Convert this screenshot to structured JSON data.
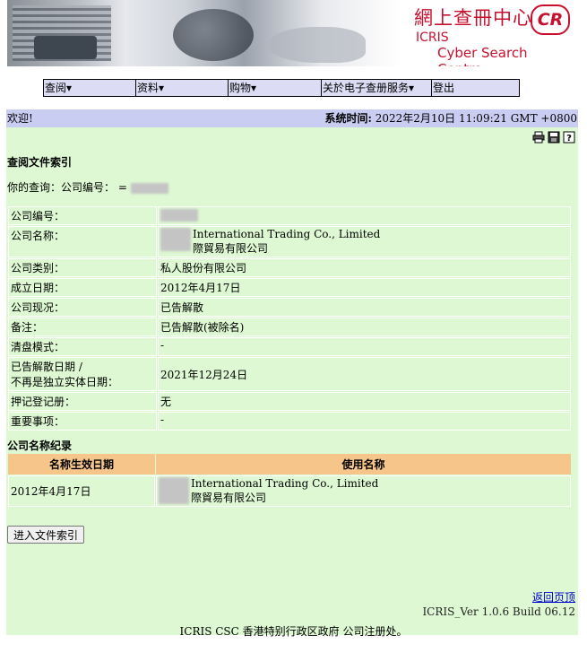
{
  "banner": {
    "title_cn": "網上查冊中心",
    "logo_text": "CR",
    "title_en_line1": "ICRIS",
    "title_en_line2": "Cyber Search Centre"
  },
  "menu": [
    {
      "label": "查阅▾"
    },
    {
      "label": "资料▾"
    },
    {
      "label": "购物▾"
    },
    {
      "label": "关於电子查册服务▾"
    },
    {
      "label": "登出"
    }
  ],
  "welcome": {
    "text": "欢迎!",
    "systime_label": "系统时间:",
    "systime_value": " 2022年2月10日 11:09:21 GMT +0800"
  },
  "toolbar_icons": [
    "printer-icon",
    "save-icon",
    "help-icon"
  ],
  "main": {
    "section_title": "查阅文件索引",
    "query_label": "你的查询：",
    "query_value": "公司编号：",
    "company": [
      {
        "label": "公司编号：",
        "value": ""
      },
      {
        "label": "公司名称：",
        "value_en": "International Trading Co., Limited",
        "value_cn": "際貿易有限公司"
      },
      {
        "label": "公司类别：",
        "value": "私人股份有限公司"
      },
      {
        "label": "成立日期：",
        "value": "2012年4月17日"
      },
      {
        "label": "公司现况：",
        "value": "已告解散"
      },
      {
        "label": "备注：",
        "value": "已告解散(被除名)"
      },
      {
        "label": "清盘模式：",
        "value": "-"
      },
      {
        "label_line1": "已告解散日期 /",
        "label_line2": "不再是独立实体日期：",
        "value": "2021年12月24日"
      },
      {
        "label": "押记登记册：",
        "value": "无"
      },
      {
        "label": "重要事项：",
        "value": "-"
      }
    ],
    "name_history_title": "公司名称纪录",
    "name_history_headers": [
      "名称生效日期",
      "使用名称"
    ],
    "name_history": [
      {
        "date": "2012年4月17日",
        "name_en": "International Trading Co., Limited",
        "name_cn": "際貿易有限公司"
      }
    ],
    "enter_button": "进入文件索引",
    "back_to_top": "返回页顶",
    "build": "ICRIS_Ver 1.0.6 Build 06.12"
  },
  "footer": "ICRIS CSC 香港特别行政区政府 公司注册处。",
  "colors": {
    "menu_bg": "#dcdcf4",
    "welcome_bg": "#c9cdf2",
    "main_bg": "#ddf8d2",
    "table_header_bg": "#f5c58a",
    "brand_red": "#c8102e"
  }
}
